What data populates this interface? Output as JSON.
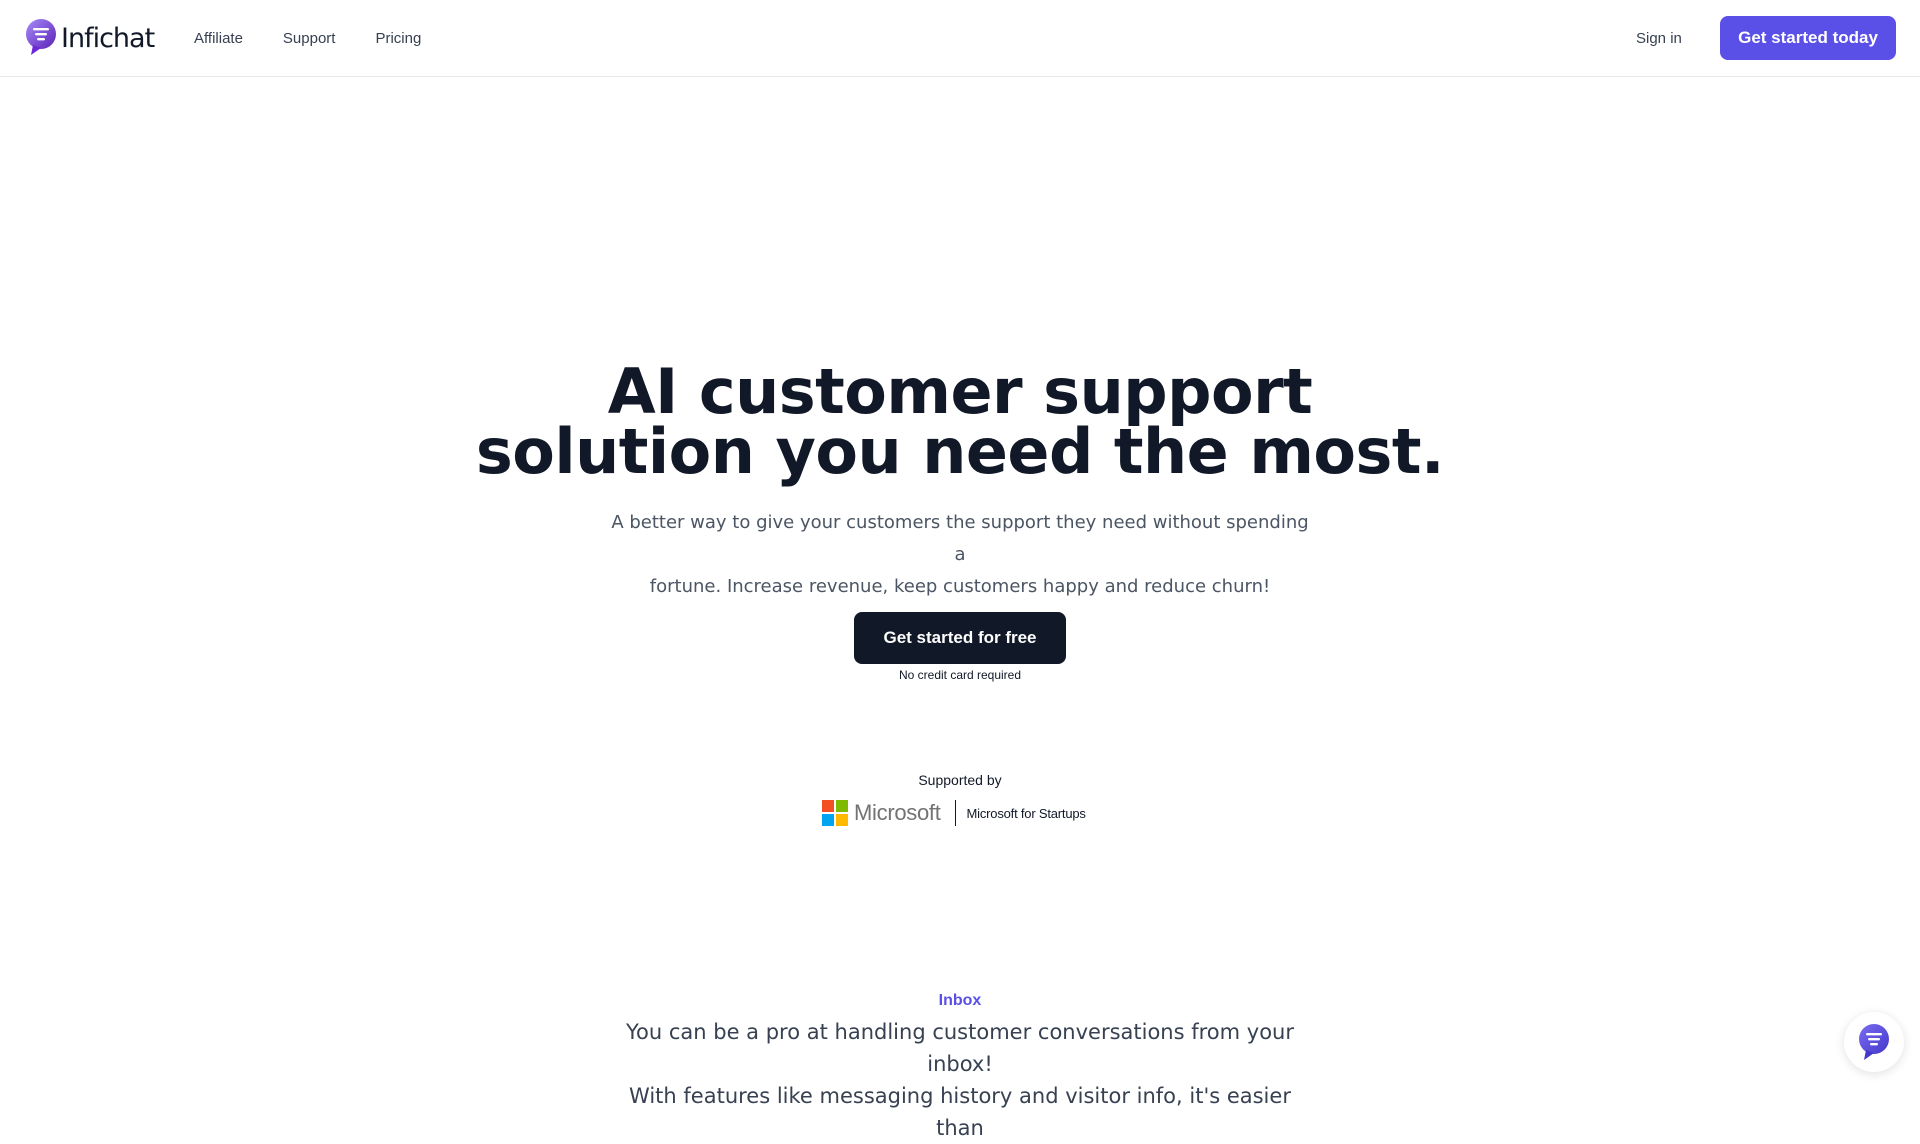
{
  "header": {
    "brand": "Infichat",
    "nav": [
      {
        "label": "Affiliate"
      },
      {
        "label": "Support"
      },
      {
        "label": "Pricing"
      }
    ],
    "signin_label": "Sign in",
    "cta_label": "Get started today"
  },
  "hero": {
    "title_line1": "AI customer support",
    "title_line2": "solution you need the most.",
    "subtitle_line1": "A better way to give your customers the support they need without spending a",
    "subtitle_line2": "fortune. Increase revenue, keep customers happy and reduce churn!",
    "cta_label": "Get started for free",
    "cta_note": "No credit card required"
  },
  "supported": {
    "label": "Supported by",
    "microsoft": "Microsoft",
    "microsoft_startups": "Microsoft for Startups"
  },
  "inbox": {
    "label": "Inbox",
    "description_line1": "You can be a pro at handling customer conversations from your inbox!",
    "description_line2": "With features like messaging history and visitor info, it's easier than"
  },
  "icons": {
    "logo": "infichat-logo-icon",
    "chat": "chat-bubble-icon",
    "microsoft": "microsoft-logo-icon"
  },
  "colors": {
    "accent": "#5a4fe6",
    "dark": "#111827",
    "ms_red": "#f25022",
    "ms_green": "#7fba00",
    "ms_blue": "#00a4ef",
    "ms_yellow": "#ffb900"
  }
}
